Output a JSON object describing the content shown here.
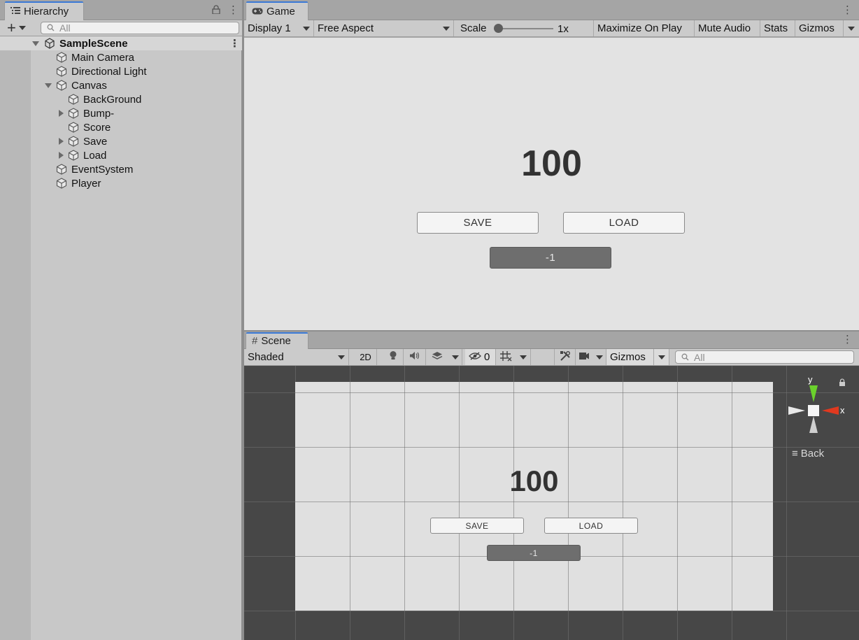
{
  "hierarchy": {
    "tab_label": "Hierarchy",
    "add_label": "+",
    "search_placeholder": "All",
    "scene_name": "SampleScene",
    "items": [
      {
        "label": "Main Camera"
      },
      {
        "label": "Directional Light"
      },
      {
        "label": "Canvas"
      },
      {
        "label": "BackGround"
      },
      {
        "label": "Bump-"
      },
      {
        "label": "Score"
      },
      {
        "label": "Save"
      },
      {
        "label": "Load"
      },
      {
        "label": "EventSystem"
      },
      {
        "label": "Player"
      }
    ]
  },
  "game": {
    "tab_label": "Game",
    "toolbar": {
      "display": "Display 1",
      "aspect": "Free Aspect",
      "scale_label": "Scale",
      "scale_value": "1x",
      "maximize": "Maximize On Play",
      "mute": "Mute Audio",
      "stats": "Stats",
      "gizmos": "Gizmos"
    },
    "score": "100",
    "save_button": "SAVE",
    "load_button": "LOAD",
    "minus_button": "-1"
  },
  "scene": {
    "tab_label": "Scene",
    "toolbar": {
      "shading": "Shaded",
      "mode_2d": "2D",
      "hidden_count": "0",
      "gizmos": "Gizmos",
      "search_placeholder": "All"
    },
    "score": "100",
    "save_button": "SAVE",
    "load_button": "LOAD",
    "minus_button": "-1",
    "gizmo": {
      "y_label": "y",
      "x_label": "x",
      "view_label": "Back"
    }
  },
  "colors": {
    "gizmo_y": "#6bd12c",
    "gizmo_x": "#e0391f",
    "tab_accent": "#3a79d6",
    "scene_bg": "#474747"
  }
}
